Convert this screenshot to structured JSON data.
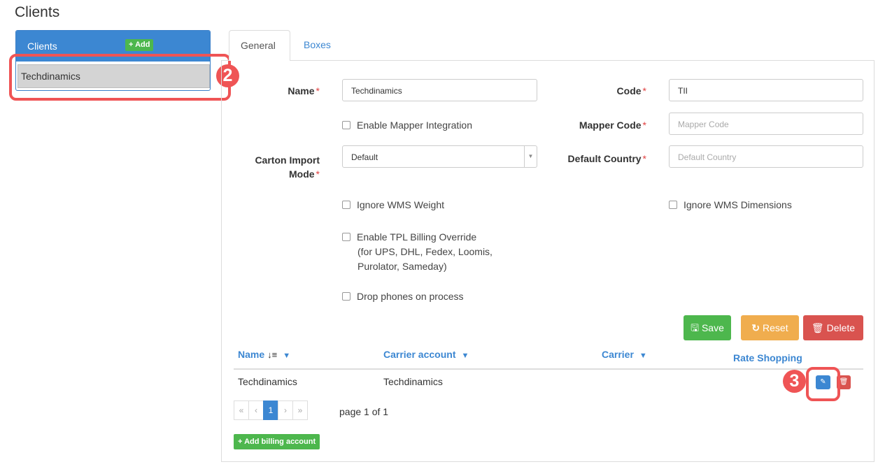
{
  "page": {
    "title": "Clients"
  },
  "sidebar": {
    "heading": "Clients",
    "add_label": "+ Add",
    "items": [
      {
        "label": "Techdinamics"
      }
    ]
  },
  "callouts": {
    "c2": "2",
    "c3": "3"
  },
  "tabs": [
    {
      "label": "General"
    },
    {
      "label": "Boxes"
    }
  ],
  "form": {
    "name": {
      "label": "Name",
      "value": "Techdinamics"
    },
    "code": {
      "label": "Code",
      "value": "TII"
    },
    "enable_mapper": {
      "label": "Enable Mapper Integration"
    },
    "mapper_code": {
      "label": "Mapper Code",
      "placeholder": "Mapper Code"
    },
    "carton_import_mode": {
      "label_line1": "Carton Import",
      "label_line2": "Mode",
      "value": "Default"
    },
    "default_country": {
      "label": "Default Country",
      "placeholder": "Default Country"
    },
    "ignore_wms_weight": {
      "label": "Ignore WMS Weight"
    },
    "ignore_wms_dimensions": {
      "label": "Ignore WMS Dimensions"
    },
    "enable_tpl": {
      "line1": "Enable TPL Billing Override",
      "line2": "(for UPS, DHL, Fedex, Loomis,",
      "line3": "Purolator, Sameday)"
    },
    "drop_phones": {
      "label": "Drop phones on process"
    },
    "required_mark": "*"
  },
  "actions": {
    "save": "Save",
    "reset": "Reset",
    "delete": "Delete"
  },
  "table": {
    "columns": [
      "Name",
      "Carrier account",
      "Carrier",
      "Rate Shopping"
    ],
    "rows": [
      {
        "name": "Techdinamics",
        "carrier_account": "Techdinamics",
        "carrier": "",
        "rate_shopping": ""
      }
    ]
  },
  "pagination": {
    "first": "«",
    "prev": "‹",
    "current": "1",
    "next": "›",
    "last": "»",
    "text": "page 1 of 1"
  },
  "billing": {
    "add_label": "+ Add billing account"
  },
  "colors": {
    "primary": "#3c87d2",
    "success": "#4db74d",
    "warning": "#f0ad4e",
    "danger": "#d9534f",
    "callout": "#ef5455"
  },
  "icons": [
    "plus-icon",
    "sort-icon",
    "filter-icon",
    "save-icon",
    "reset-icon",
    "trash-icon",
    "edit-icon",
    "caret-down-icon"
  ]
}
